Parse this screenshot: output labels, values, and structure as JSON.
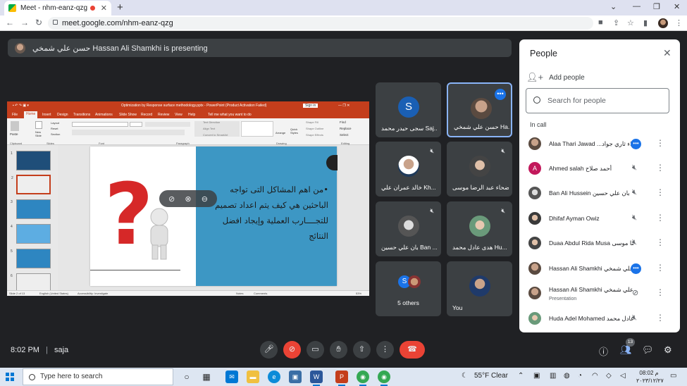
{
  "browser": {
    "tab_title": "Meet - nhm-eanz-qzg",
    "url": "meet.google.com/nhm-eanz-qzg"
  },
  "presenting_bar": {
    "text": "حسن علي شمخي Hassan Ali Shamkhi is presenting"
  },
  "presentation": {
    "window_title": "Optimization by Response surface methodology.pptx  -  PowerPoint (Product Activation Failed)",
    "signin": "Sign in",
    "ribbon_tabs": [
      "File",
      "Home",
      "Insert",
      "Design",
      "Transitions",
      "Animations",
      "Slide Show",
      "Record",
      "Review",
      "View",
      "Help"
    ],
    "tell_me": "Tell me what you want to do",
    "groups": [
      "Clipboard",
      "Slides",
      "Font",
      "Paragraph",
      "Drawing",
      "Editing"
    ],
    "ribbon_items": [
      "Paste",
      "New Slide",
      "Layout",
      "Reset",
      "Section",
      "Text Direction",
      "Align Text",
      "Convert to SmartArt",
      "Arrange",
      "Quick Styles",
      "Shape Fill",
      "Shape Outline",
      "Shape Effects",
      "Find",
      "Replace",
      "Select"
    ],
    "thumb_numbers": [
      "1",
      "2",
      "3",
      "4",
      "5",
      "6"
    ],
    "slide_text": "•من اهم المشاكل التى تواجه الباحثين هي كيف يتم اعداد تصميم للتجــــارب العملية وإيجاد افضل النتائج",
    "status_slide": "Slide 2 of 13",
    "status_lang": "English (United States)",
    "status_access": "Accessibility: Investigate",
    "status_notes": "Notes",
    "status_comments": "Comments",
    "status_zoom": "53%"
  },
  "tiles": [
    {
      "name": "سجى حيدر محمد Saj...",
      "letter": "S"
    },
    {
      "name": "حسن علي شمخي Ha..."
    },
    {
      "name": "خالد عمران علي Kh..."
    },
    {
      "name": "ضحاء عبد الرضا موسى..."
    },
    {
      "name": "بان علي حسين Ban ..."
    },
    {
      "name": "هدى عادل محمد Hu..."
    },
    {
      "name": "5 others",
      "letter": "S"
    },
    {
      "name": "You"
    }
  ],
  "people": {
    "title": "People",
    "add_label": "Add people",
    "search_placeholder": "Search for people",
    "section": "In call",
    "list": [
      {
        "name": "Alaa Thari Jawad ...علاء ثاري جواد (You)"
      },
      {
        "name": "Ahmed salah أحمد صلاح",
        "letter": "A"
      },
      {
        "name": "Ban Ali Hussein بان علي حسين"
      },
      {
        "name": "Dhifaf Ayman Owiz"
      },
      {
        "name": "Duaa Abdul Rida Musa ضحاء عبد الرضا موسى"
      },
      {
        "name": "Hassan Ali Shamkhi حسن علي شمخي"
      },
      {
        "name": "Hassan Ali Shamkhi حسن علي شمخي",
        "sub": "Presentation"
      },
      {
        "name": "Huda Adel Mohamed هدى عادل محمد"
      }
    ]
  },
  "bottom": {
    "time": "8:02 PM",
    "separator": "|",
    "meeting": "saja",
    "people_count": "13",
    "dots": "⋮"
  },
  "taskbar": {
    "search_placeholder": "Type here to search",
    "weather": "55°F  Clear",
    "time": "08:02 م",
    "date": "٢٠٢٣/١٢/٢٧"
  },
  "colors": {
    "accent": "#1a73e8",
    "danger": "#ea4335",
    "ppt": "#c43e1c",
    "slide_blue": "#3d97c4"
  }
}
